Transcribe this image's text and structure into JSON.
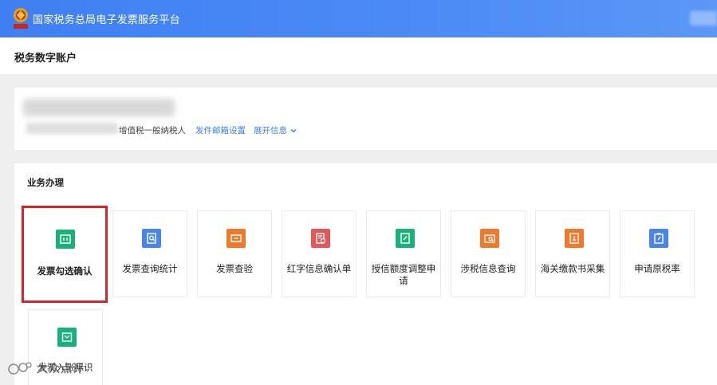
{
  "header": {
    "app_title": "国家税务总局电子发票服务平台",
    "brand_color": "#4285f4"
  },
  "subheader": {
    "page_title": "税务数字账户"
  },
  "account": {
    "taxpayer_type": "增值税一般纳税人",
    "email_link": "发件邮箱设置",
    "expand_link": "展开信息"
  },
  "business": {
    "title": "业务办理",
    "tiles": [
      {
        "label": "发票勾选确认",
        "icon": "ticket-icon",
        "color": "#19b07a"
      },
      {
        "label": "发票查询统计",
        "icon": "search-doc-icon",
        "color": "#4a86e8"
      },
      {
        "label": "发票查验",
        "icon": "ticket-icon",
        "color": "#f07a2c"
      },
      {
        "label": "红字信息确认单",
        "icon": "doc-check-icon",
        "color": "#e55656"
      },
      {
        "label": "授信额度调整申请",
        "icon": "edit-doc-icon",
        "color": "#19b07a"
      },
      {
        "label": "涉税信息查询",
        "icon": "folder-search-icon",
        "color": "#f07a2c"
      },
      {
        "label": "海关缴款书采集",
        "icon": "anchor-doc-icon",
        "color": "#f07a2c"
      },
      {
        "label": "申请原税率",
        "icon": "clipboard-icon",
        "color": "#4a86e8"
      },
      {
        "label": "发票入账标识",
        "icon": "tray-icon",
        "color": "#19b07a"
      }
    ]
  },
  "watermark": {
    "text": "大众点评"
  }
}
